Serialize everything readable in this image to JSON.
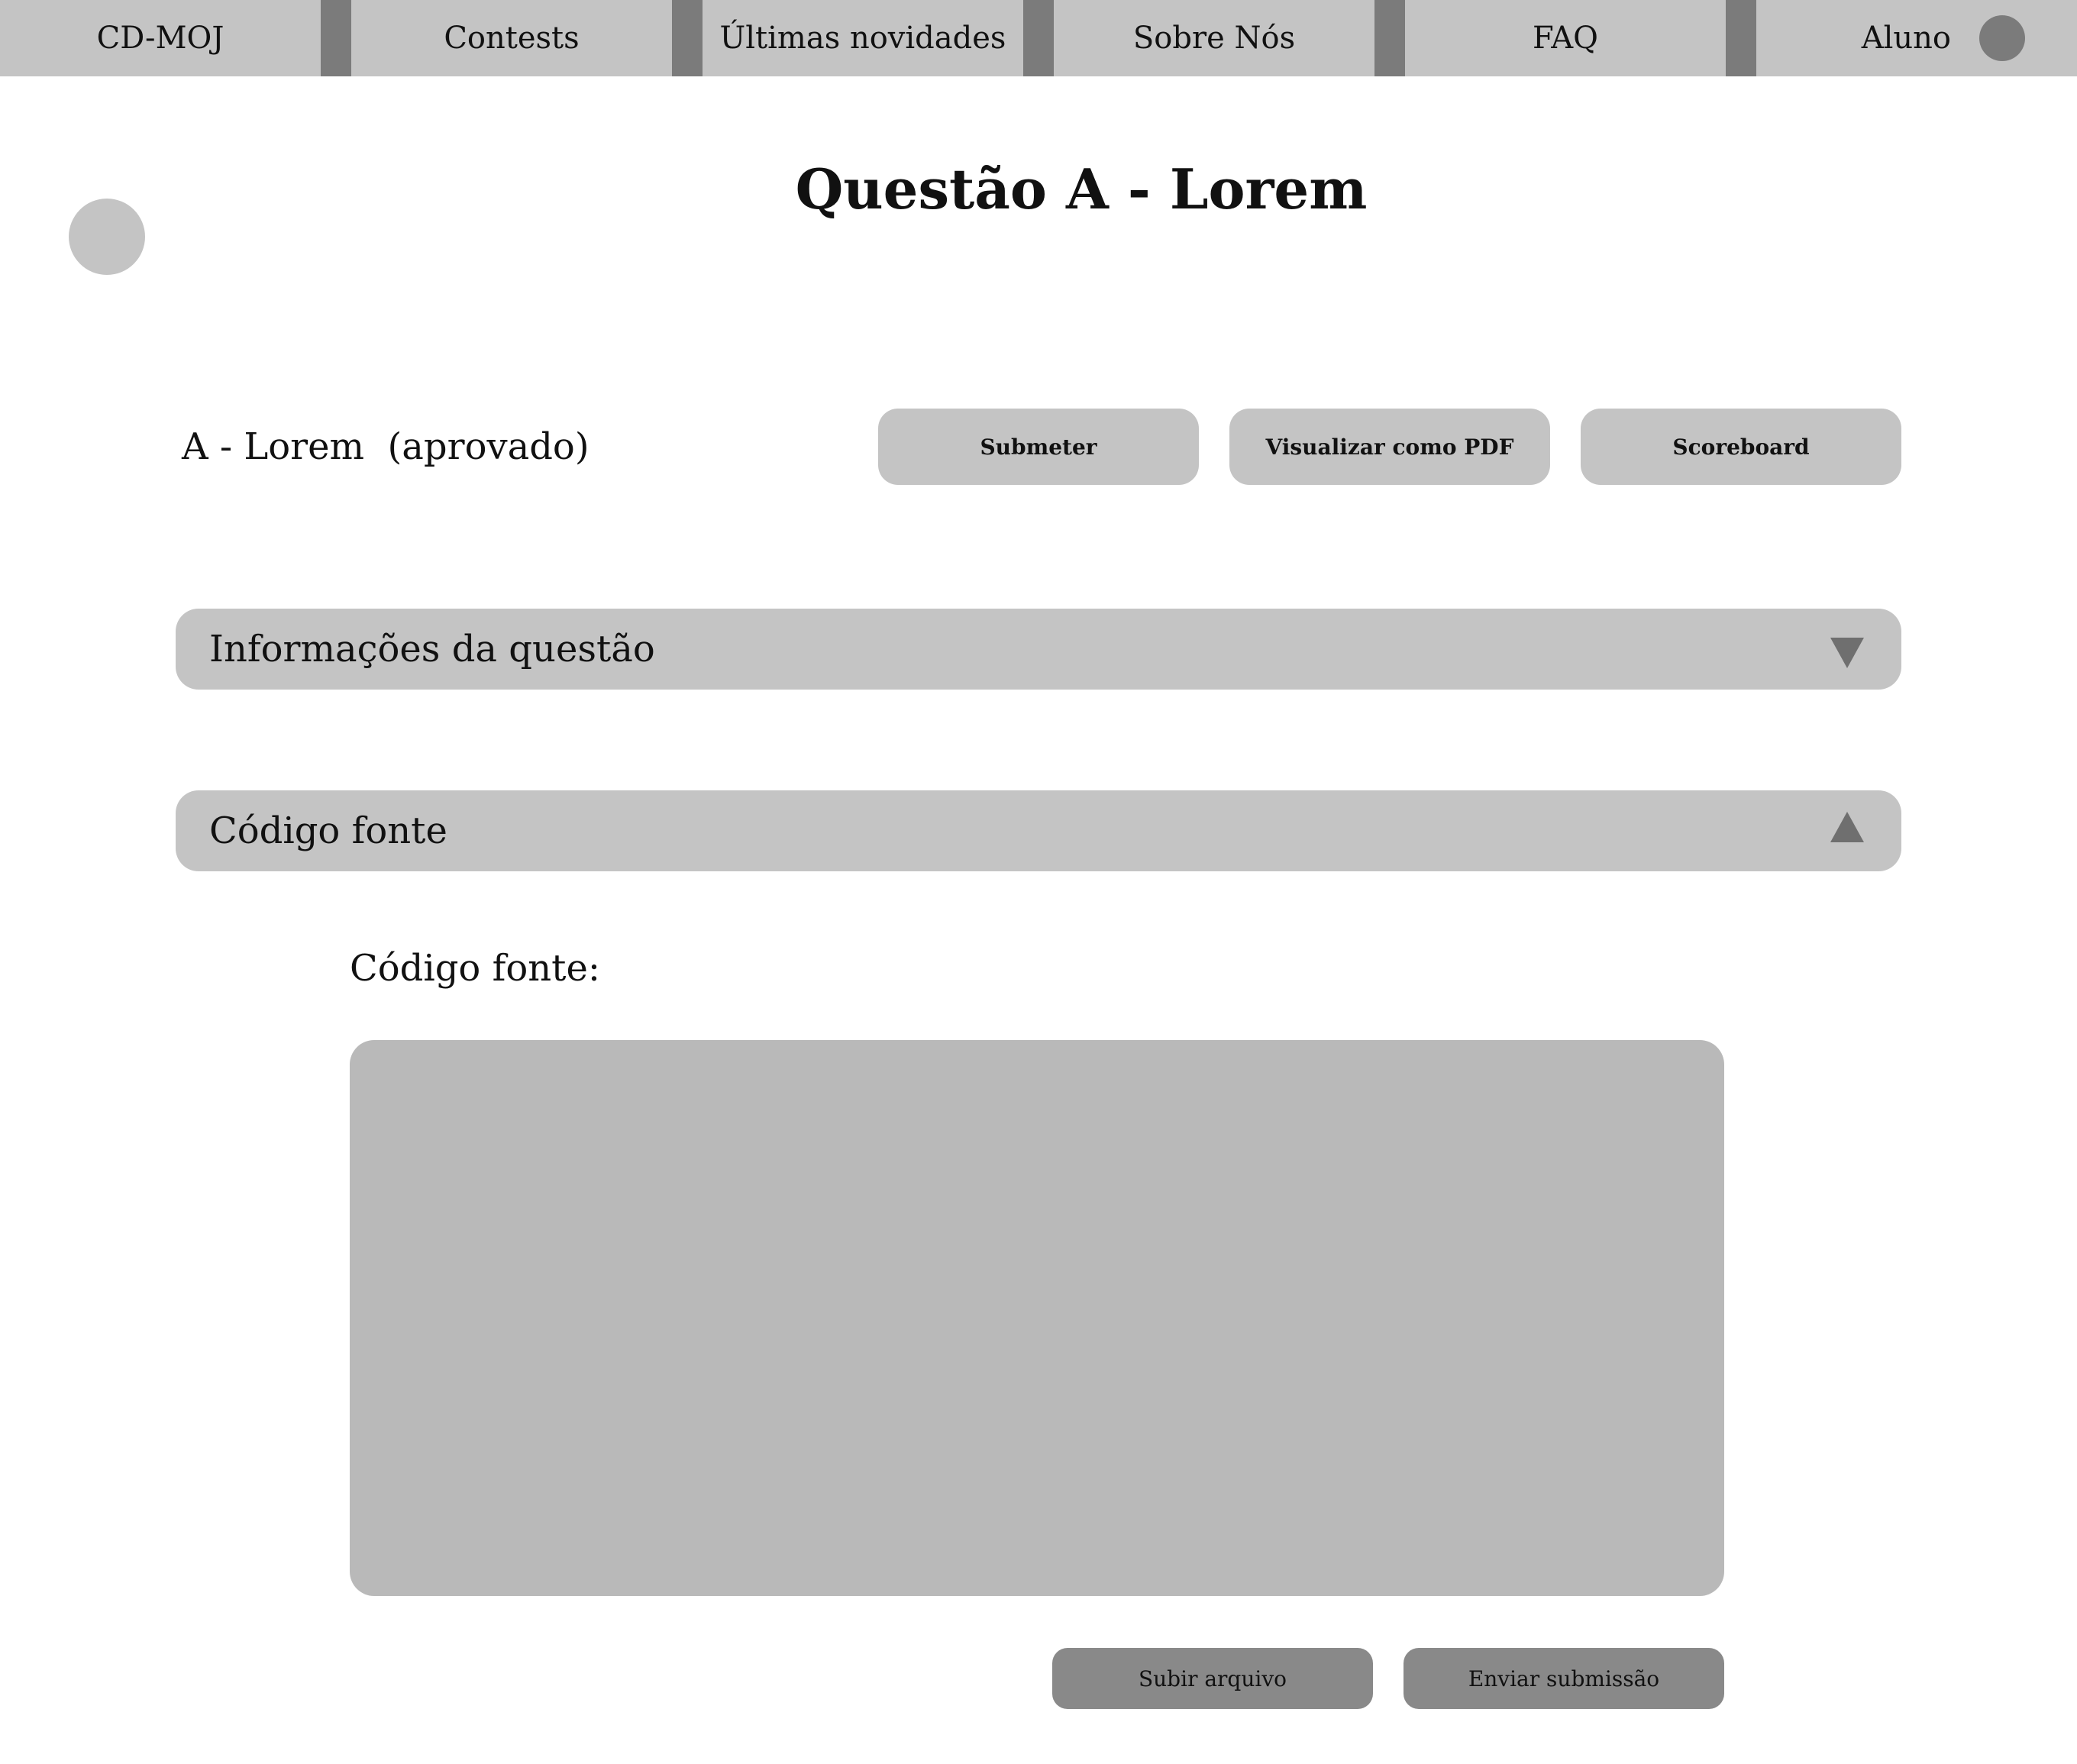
{
  "nav": {
    "items": [
      {
        "label": "CD-MOJ"
      },
      {
        "label": "Contests"
      },
      {
        "label": "Últimas novidades"
      },
      {
        "label": "Sobre Nós"
      },
      {
        "label": "FAQ"
      }
    ],
    "user_label": "Aluno"
  },
  "page": {
    "title": "Questão A - Lorem"
  },
  "problem": {
    "name": "A - Lorem  (aprovado)",
    "buttons": {
      "submit": "Submeter",
      "pdf": "Visualizar como PDF",
      "scoreboard": "Scoreboard"
    }
  },
  "accordions": {
    "info": {
      "label": "Informações da questão",
      "state": "collapsed",
      "icon": "chevron-down-icon"
    },
    "code": {
      "label": "Código fonte",
      "state": "expanded",
      "icon": "chevron-up-icon"
    }
  },
  "source": {
    "label": "Código fonte:",
    "value": "",
    "upload_label": "Subir arquivo",
    "send_label": "Enviar submissão"
  },
  "colors": {
    "nav_bg": "#c4c4c4",
    "nav_separator": "#7b7b7b",
    "button_light": "#c4c4c4",
    "button_dark": "#898989",
    "code_area": "#b9b9b9"
  }
}
